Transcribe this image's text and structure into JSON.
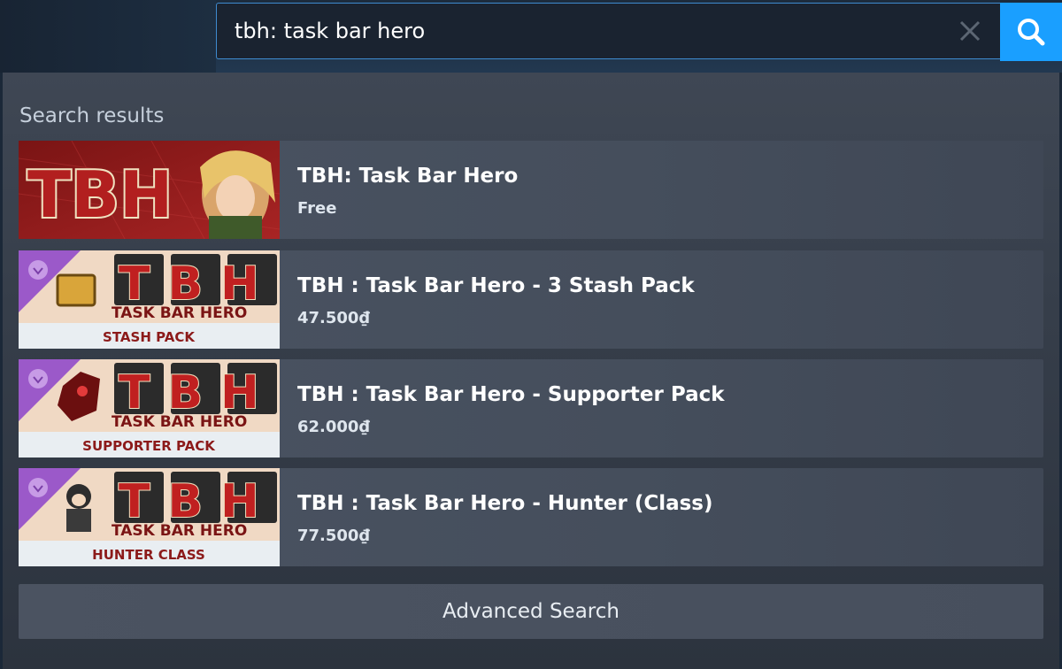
{
  "search": {
    "value": "tbh: task bar hero",
    "clear_icon": "close-icon",
    "submit_icon": "search-icon"
  },
  "results_heading": "Search results",
  "results": [
    {
      "title": "TBH: Task Bar Hero",
      "price": "Free",
      "thumb_logo": "TBH",
      "thumb_caption": ""
    },
    {
      "title": "TBH : Task Bar Hero - 3 Stash Pack",
      "price": "47.500₫",
      "thumb_logo": "TBH",
      "thumb_subtitle": "TASK BAR HERO",
      "thumb_caption": "STASH PACK"
    },
    {
      "title": "TBH : Task Bar Hero - Supporter Pack",
      "price": "62.000₫",
      "thumb_logo": "TBH",
      "thumb_subtitle": "TASK BAR HERO",
      "thumb_caption": "SUPPORTER PACK"
    },
    {
      "title": "TBH : Task Bar Hero - Hunter (Class)",
      "price": "77.500₫",
      "thumb_logo": "TBH",
      "thumb_subtitle": "TASK BAR HERO",
      "thumb_caption": "HUNTER CLASS"
    }
  ],
  "advanced_search_label": "Advanced Search",
  "colors": {
    "accent": "#1a9fff",
    "logo_red": "#8c1a1a",
    "dlc_badge": "#9b59c9"
  }
}
